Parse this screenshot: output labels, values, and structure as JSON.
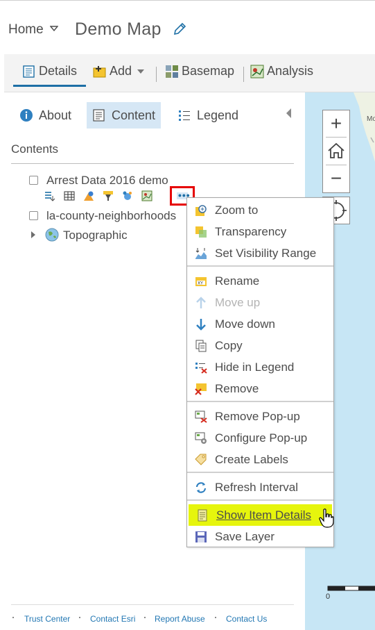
{
  "header": {
    "home_label": "Home",
    "map_title": "Demo Map"
  },
  "toolbar": {
    "details": "Details",
    "add": "Add",
    "basemap": "Basemap",
    "analysis": "Analysis"
  },
  "panel": {
    "tabs": {
      "about": "About",
      "content": "Content",
      "legend": "Legend"
    },
    "contents_label": "Contents",
    "layers": [
      {
        "name": "Arrest Data 2016 demo"
      },
      {
        "name": "la-county-neighborhoods"
      },
      {
        "name": "Topographic"
      }
    ],
    "more_label": "•••"
  },
  "context_menu": {
    "items": [
      {
        "label": "Zoom to"
      },
      {
        "label": "Transparency"
      },
      {
        "label": "Set Visibility Range"
      },
      {
        "label": "Rename"
      },
      {
        "label": "Move up"
      },
      {
        "label": "Move down"
      },
      {
        "label": "Copy"
      },
      {
        "label": "Hide in Legend"
      },
      {
        "label": "Remove"
      },
      {
        "label": "Remove Pop-up"
      },
      {
        "label": "Configure Pop-up"
      },
      {
        "label": "Create Labels"
      },
      {
        "label": "Refresh Interval"
      },
      {
        "label": "Show Item Details"
      },
      {
        "label": "Save Layer"
      }
    ]
  },
  "map": {
    "zoom_in": "+",
    "zoom_out": "−",
    "scale_zero": "0",
    "place_label": "Mo"
  },
  "footer": {
    "links": [
      "Trust Center",
      "Contact Esri",
      "Report Abuse",
      "Contact Us"
    ]
  },
  "colors": {
    "accent": "#1d6fa5",
    "highlight": "#e6f50d",
    "outline_red": "#e60000",
    "active_tab_bg": "#d6e7f5",
    "water": "#c7e6f5"
  }
}
